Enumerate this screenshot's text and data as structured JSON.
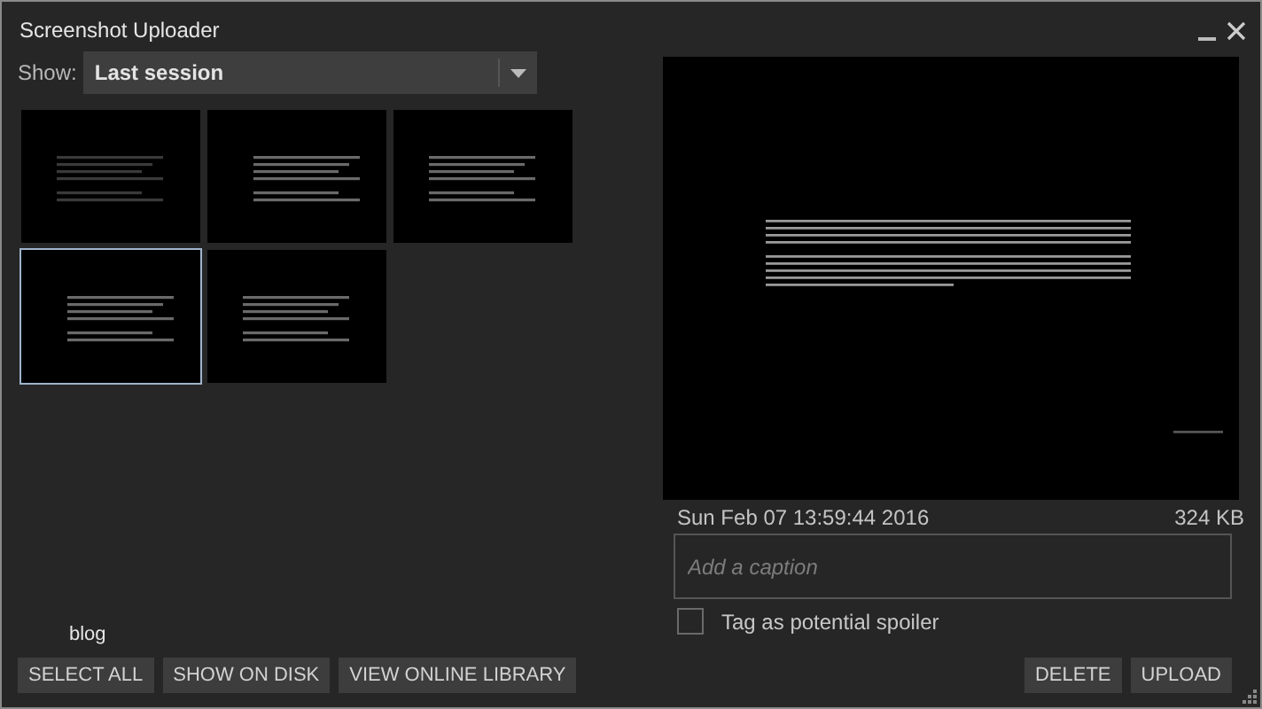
{
  "window": {
    "title": "Screenshot Uploader"
  },
  "filter": {
    "label": "Show:",
    "value": "Last session"
  },
  "thumbnails": [
    {
      "kind": "picture",
      "selected": false
    },
    {
      "kind": "picture",
      "selected": false
    },
    {
      "kind": "picture",
      "selected": false
    },
    {
      "kind": "picture",
      "selected": true
    },
    {
      "kind": "picture",
      "selected": false
    }
  ],
  "blog_label": "blog",
  "left_buttons": [
    "SELECT ALL",
    "SHOW ON DISK",
    "VIEW ONLINE LIBRARY"
  ],
  "preview": {
    "kind": "picture",
    "date": "Sun Feb 07 13:59:44 2016",
    "size": "324 KB"
  },
  "caption": {
    "placeholder": "Add a caption"
  },
  "spoiler": {
    "label": "Tag as potential spoiler",
    "checked": false
  },
  "right_buttons": [
    "DELETE",
    "UPLOAD"
  ]
}
